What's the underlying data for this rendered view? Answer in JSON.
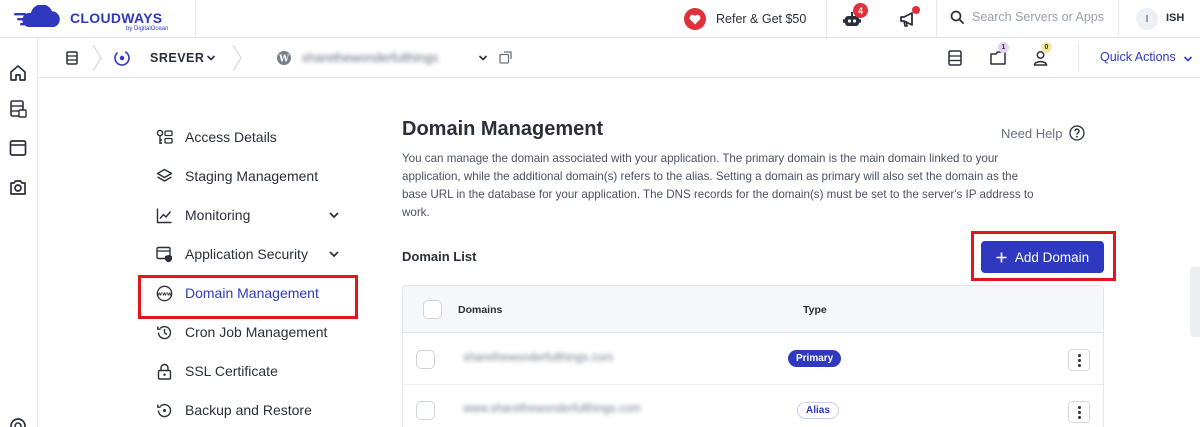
{
  "header": {
    "logo_text": "CLOUDWAYS",
    "logo_sub": "by DigitalOcean",
    "refer_label": "Refer & Get $50",
    "bot_badge": "4",
    "search_placeholder": "Search Servers or Apps",
    "avatar_initial": "I",
    "user_name": "ISH"
  },
  "subheader": {
    "server_name": "SREVER",
    "app_name": "sharethewonderfulthings",
    "badge_one": "1",
    "badge_two": "0",
    "quick_actions_label": "Quick Actions"
  },
  "side_nav": {
    "items": [
      {
        "label": "Access Details",
        "icon": "key-list-icon"
      },
      {
        "label": "Staging Management",
        "icon": "layers-icon"
      },
      {
        "label": "Monitoring",
        "icon": "chart-line-icon"
      },
      {
        "label": "Application Security",
        "icon": "shield-window-icon"
      },
      {
        "label": "Domain Management",
        "icon": "www-globe-icon"
      },
      {
        "label": "Cron Job Management",
        "icon": "history-clock-icon"
      },
      {
        "label": "SSL Certificate",
        "icon": "lock-icon"
      },
      {
        "label": "Backup and Restore",
        "icon": "backup-icon"
      }
    ]
  },
  "main": {
    "title": "Domain Management",
    "need_help": "Need Help",
    "description": "You can manage the domain associated with your application. The primary domain is the main domain linked to your application, while the additional domain(s) refers to the alias. Setting a domain as primary will also set the domain as the base URL in the database for your application. The DNS records for the domain(s) must be set to the server's IP address to work.",
    "list_heading": "Domain List",
    "add_button": "Add Domain",
    "table": {
      "columns": [
        "Domains",
        "Type"
      ],
      "rows": [
        {
          "domain": "sharethewonderfulthings.com",
          "type": "Primary"
        },
        {
          "domain": "www.sharethewonderfulthings.com",
          "type": "Alias"
        }
      ]
    }
  },
  "colors": {
    "brand": "#2f39bf",
    "accent_red": "#e0303c",
    "highlight": "#e1151b"
  }
}
